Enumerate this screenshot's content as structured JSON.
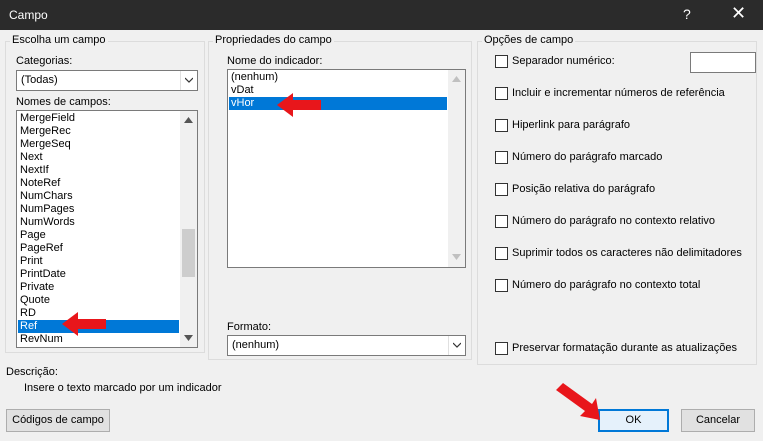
{
  "window": {
    "title": "Campo",
    "help": "?",
    "close": "✕"
  },
  "left": {
    "group_title": "Escolha um campo",
    "categories_label": "Categorias:",
    "categories_value": "(Todas)",
    "fields_label": "Nomes de campos:",
    "fields": [
      "MergeField",
      "MergeRec",
      "MergeSeq",
      "Next",
      "NextIf",
      "NoteRef",
      "NumChars",
      "NumPages",
      "NumWords",
      "Page",
      "PageRef",
      "Print",
      "PrintDate",
      "Private",
      "Quote",
      "RD",
      "Ref",
      "RevNum"
    ],
    "selected_field": "Ref"
  },
  "middle": {
    "group_title": "Propriedades do campo",
    "bookmark_label": "Nome do indicador:",
    "bookmarks": [
      "(nenhum)",
      "vDat",
      "vHor"
    ],
    "selected_bookmark": "vHor",
    "format_label": "Formato:",
    "format_value": "(nenhum)"
  },
  "right": {
    "group_title": "Opções de campo",
    "options": [
      {
        "label": "Separador numérico:",
        "checked": false
      },
      {
        "label": "Incluir e incrementar números de referência",
        "checked": false
      },
      {
        "label": "Hiperlink para parágrafo",
        "checked": false
      },
      {
        "label": "Número do parágrafo marcado",
        "checked": false
      },
      {
        "label": "Posição relativa do parágrafo",
        "checked": false
      },
      {
        "label": "Número do parágrafo no contexto relativo",
        "checked": false
      },
      {
        "label": "Suprimir todos os caracteres não delimitadores",
        "checked": false
      },
      {
        "label": "Número do parágrafo no contexto total",
        "checked": false
      }
    ],
    "preserve_label": "Preservar formatação durante as atualizações"
  },
  "description": {
    "label": "Descrição:",
    "text": "Insere o texto marcado por um indicador"
  },
  "buttons": {
    "field_codes": "Códigos de campo",
    "ok": "OK",
    "cancel": "Cancelar"
  },
  "colors": {
    "selection": "#0078d7",
    "annotation_arrow": "#e8161b"
  }
}
